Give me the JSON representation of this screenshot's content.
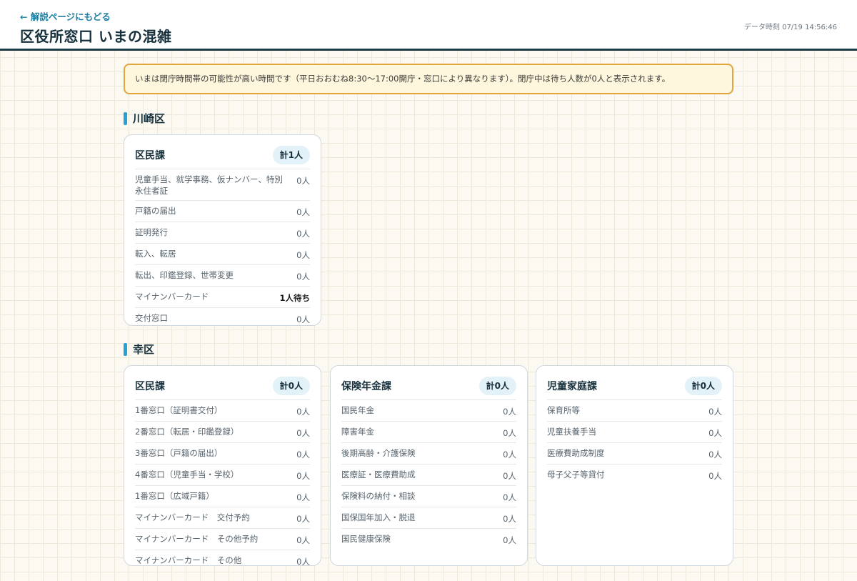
{
  "header": {
    "back_link": "← 解説ページにもどる",
    "title": "区役所窓口 いまの混雑",
    "data_time": "データ時刻 07/19 14:56:46"
  },
  "notice": "いまは閉庁時間帯の可能性が高い時間です（平日おおむね8:30〜17:00開庁・窓口により異なります）。閉庁中は待ち人数が0人と表示されます。",
  "sections": [
    {
      "ward": "川崎区",
      "cards": [
        {
          "title": "区民課",
          "total": "計1人",
          "rows": [
            {
              "name": "児童手当、就学事務、仮ナンバー、特別永住者証",
              "count": "0人"
            },
            {
              "name": "戸籍の届出",
              "count": "0人"
            },
            {
              "name": "証明発行",
              "count": "0人"
            },
            {
              "name": "転入、転居",
              "count": "0人"
            },
            {
              "name": "転出、印鑑登録、世帯変更",
              "count": "0人"
            },
            {
              "name": "マイナンバーカード",
              "count": "1人待ち"
            },
            {
              "name": "交付窓口",
              "count": "0人"
            }
          ]
        }
      ]
    },
    {
      "ward": "幸区",
      "cards": [
        {
          "title": "区民課",
          "total": "計0人",
          "rows": [
            {
              "name": "1番窓口（証明書交付）",
              "count": "0人"
            },
            {
              "name": "2番窓口（転居・印鑑登録）",
              "count": "0人"
            },
            {
              "name": "3番窓口（戸籍の届出）",
              "count": "0人"
            },
            {
              "name": "4番窓口（児童手当・学校）",
              "count": "0人"
            },
            {
              "name": "1番窓口（広域戸籍）",
              "count": "0人"
            },
            {
              "name": "マイナンバーカード　交付予約",
              "count": "0人"
            },
            {
              "name": "マイナンバーカード　その他予約",
              "count": "0人"
            },
            {
              "name": "マイナンバーカード　その他",
              "count": "0人"
            }
          ]
        },
        {
          "title": "保険年金課",
          "total": "計0人",
          "rows": [
            {
              "name": "国民年金",
              "count": "0人"
            },
            {
              "name": "障害年金",
              "count": "0人"
            },
            {
              "name": "後期高齢・介護保険",
              "count": "0人"
            },
            {
              "name": "医療証・医療費助成",
              "count": "0人"
            },
            {
              "name": "保険料の納付・相談",
              "count": "0人"
            },
            {
              "name": "国保国年加入・脱退",
              "count": "0人"
            },
            {
              "name": "国民健康保険",
              "count": "0人"
            }
          ]
        },
        {
          "title": "児童家庭課",
          "total": "計0人",
          "rows": [
            {
              "name": "保育所等",
              "count": "0人"
            },
            {
              "name": "児童扶養手当",
              "count": "0人"
            },
            {
              "name": "医療費助成制度",
              "count": "0人"
            },
            {
              "name": "母子父子等貸付",
              "count": "0人"
            }
          ]
        }
      ]
    }
  ]
}
